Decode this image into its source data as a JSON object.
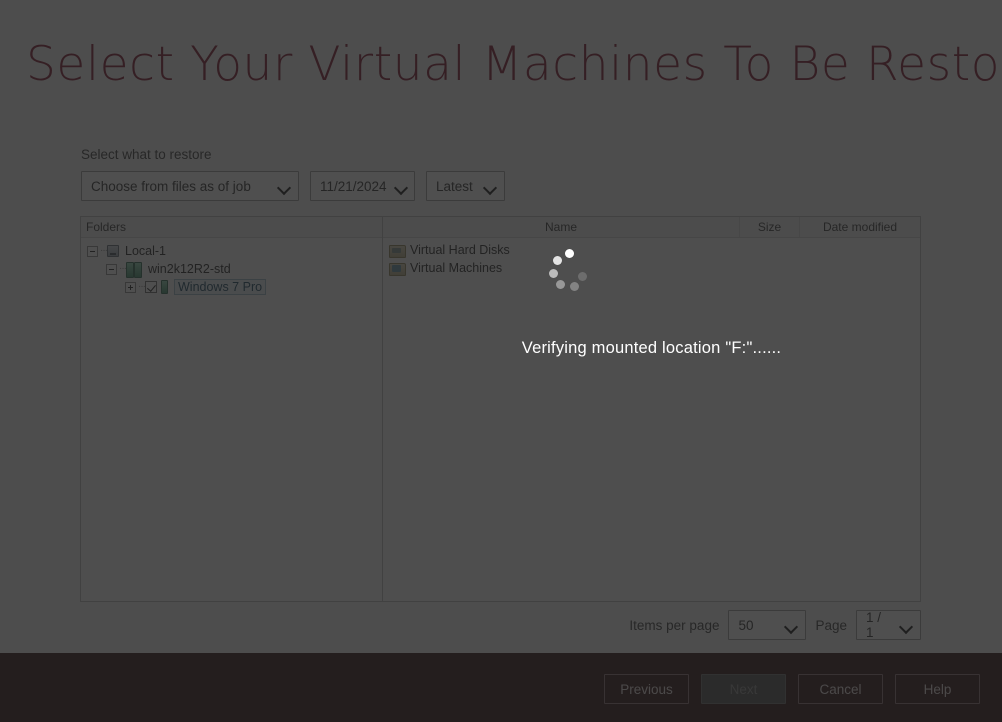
{
  "page": {
    "title": "Select Your Virtual Machines To Be Restored",
    "title_color": "#7d1128",
    "footer_color": "#2b0a0d"
  },
  "restore": {
    "label": "Select what to restore",
    "source_select": "Choose from files as of job",
    "date_select": "11/21/2024",
    "version_select": "Latest",
    "caret_icon": "chevron-down-icon"
  },
  "tree": {
    "header": "Folders",
    "nodes": [
      {
        "label": "Local-1",
        "level": 1,
        "icon": "host-icon",
        "expander": "minus",
        "checkbox": false,
        "selected": false
      },
      {
        "label": "win2k12R2-std",
        "level": 2,
        "icon": "server-pair-icon",
        "expander": "minus",
        "checkbox": false,
        "selected": false
      },
      {
        "label": "Windows 7 Pro",
        "level": 3,
        "icon": "server-icon",
        "expander": "plus",
        "checkbox": true,
        "selected": true
      }
    ]
  },
  "filelist": {
    "columns": [
      "Name",
      "Size",
      "Date modified"
    ],
    "rows": [
      {
        "name": "Virtual Hard Disks",
        "icon": "folder-disk-icon",
        "size": "",
        "date": ""
      },
      {
        "name": "Virtual Machines",
        "icon": "folder-vm-icon",
        "size": "",
        "date": ""
      }
    ]
  },
  "busy": {
    "status": "Verifying mounted location \"F:\"......",
    "spinner_icon": "loading-spinner-icon"
  },
  "pagination": {
    "items_label": "Items per page",
    "items_value": "50",
    "page_label": "Page",
    "page_value": "1 / 1"
  },
  "footer": {
    "buttons": [
      {
        "label": "Previous",
        "disabled": false
      },
      {
        "label": "Next",
        "disabled": true
      },
      {
        "label": "Cancel",
        "disabled": false
      },
      {
        "label": "Help",
        "disabled": false
      }
    ]
  }
}
